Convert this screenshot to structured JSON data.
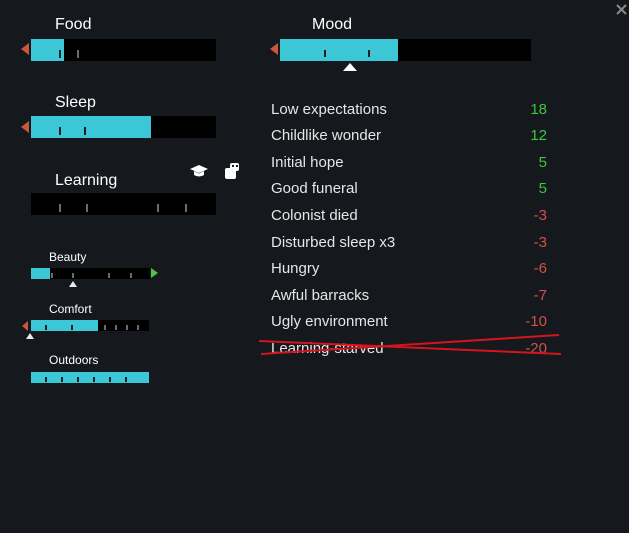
{
  "needs": {
    "food": {
      "label": "Food",
      "level": 0.18
    },
    "mood": {
      "label": "Mood",
      "level": 0.47
    },
    "sleep": {
      "label": "Sleep",
      "level": 0.65
    },
    "learning": {
      "label": "Learning",
      "level": 0.0
    }
  },
  "learning_icons": [
    "graduation-cap-icon",
    "robot-icon"
  ],
  "small_needs": {
    "beauty": {
      "label": "Beauty",
      "level": 0.16
    },
    "comfort": {
      "label": "Comfort",
      "level": 0.57
    },
    "outdoors": {
      "label": "Outdoors",
      "level": 1.0
    }
  },
  "thoughts": [
    {
      "label": "Low expectations",
      "value": "18",
      "sign": "positive"
    },
    {
      "label": "Childlike wonder",
      "value": "12",
      "sign": "positive"
    },
    {
      "label": "Initial hope",
      "value": "5",
      "sign": "positive"
    },
    {
      "label": "Good funeral",
      "value": "5",
      "sign": "positive"
    },
    {
      "label": "Colonist died",
      "value": "-3",
      "sign": "negative"
    },
    {
      "label": "Disturbed sleep x3",
      "value": "-3",
      "sign": "negative"
    },
    {
      "label": "Hungry",
      "value": "-6",
      "sign": "negative"
    },
    {
      "label": "Awful barracks",
      "value": "-7",
      "sign": "negative"
    },
    {
      "label": "Ugly environment",
      "value": "-10",
      "sign": "negative"
    },
    {
      "label": "Learning-starved",
      "value": "-20",
      "sign": "negative",
      "crossed_out": true
    }
  ],
  "colors": {
    "background": "#15181d",
    "bar_fill": "#3cc7d7",
    "positive": "#3cc83c",
    "negative": "#d0524a",
    "strike": "#d4141e"
  }
}
